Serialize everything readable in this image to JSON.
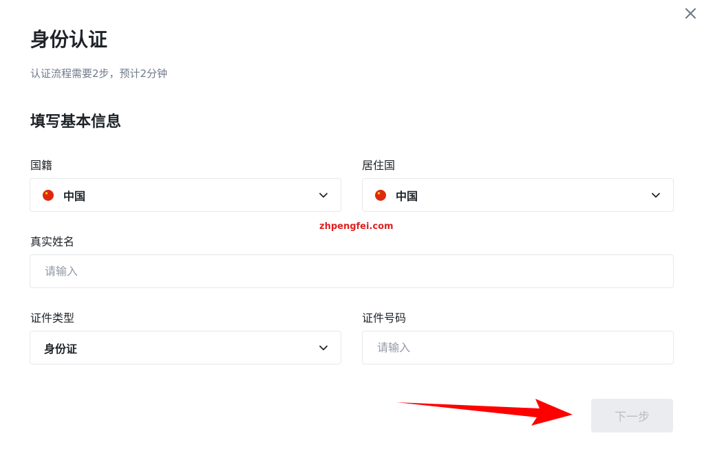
{
  "dialog": {
    "title": "身份认证",
    "subtitle": "认证流程需要2步，预计2分钟"
  },
  "form": {
    "section_title": "填写基本信息",
    "nationality": {
      "label": "国籍",
      "value": "中国",
      "icon": "china-flag-icon"
    },
    "residence": {
      "label": "居住国",
      "value": "中国",
      "icon": "china-flag-icon"
    },
    "real_name": {
      "label": "真实姓名",
      "placeholder": "请输入"
    },
    "id_type": {
      "label": "证件类型",
      "value": "身份证"
    },
    "id_number": {
      "label": "证件号码",
      "placeholder": "请输入"
    },
    "next_label": "下一步"
  },
  "watermark": "zhpengfei.com",
  "colors": {
    "flag_red": "#de2910",
    "arrow_red": "#ff0000",
    "button_disabled_bg": "#eaecef",
    "button_disabled_text": "#b7bdc6"
  }
}
